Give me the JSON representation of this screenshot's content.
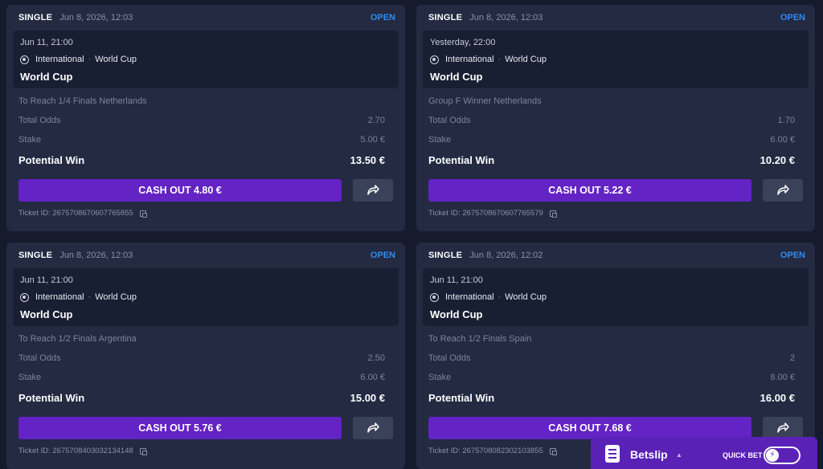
{
  "colors": {
    "background": "#151a2c",
    "card": "#232a42",
    "accent": "#6423c4",
    "open": "#2f8cf0"
  },
  "tickets": [
    {
      "type": "SINGLE",
      "placed": "Jun 8, 2026, 12:03",
      "status": "OPEN",
      "event_time": "Jun 11, 21:00",
      "category": "International",
      "competition": "World Cup",
      "event_title": "World Cup",
      "market": "To Reach 1/4 Finals Netherlands",
      "odds_label": "Total Odds",
      "odds": "2.70",
      "stake_label": "Stake",
      "stake": "5.00 €",
      "win_label": "Potential Win",
      "win": "13.50 €",
      "cashout": "CASH OUT 4.80 €",
      "ticket_id": "Ticket ID: 2675708670607765855"
    },
    {
      "type": "SINGLE",
      "placed": "Jun 8, 2026, 12:03",
      "status": "OPEN",
      "event_time": "Yesterday, 22:00",
      "category": "International",
      "competition": "World Cup",
      "event_title": "World Cup",
      "market": "Group F Winner Netherlands",
      "odds_label": "Total Odds",
      "odds": "1.70",
      "stake_label": "Stake",
      "stake": "6.00 €",
      "win_label": "Potential Win",
      "win": "10.20 €",
      "cashout": "CASH OUT 5.22 €",
      "ticket_id": "Ticket ID: 2675708670607765579"
    },
    {
      "type": "SINGLE",
      "placed": "Jun 8, 2026, 12:03",
      "status": "OPEN",
      "event_time": "Jun 11, 21:00",
      "category": "International",
      "competition": "World Cup",
      "event_title": "World Cup",
      "market": "To Reach 1/2 Finals Argentina",
      "odds_label": "Total Odds",
      "odds": "2.50",
      "stake_label": "Stake",
      "stake": "6.00 €",
      "win_label": "Potential Win",
      "win": "15.00 €",
      "cashout": "CASH OUT 5.76 €",
      "ticket_id": "Ticket ID: 2675708403032134148"
    },
    {
      "type": "SINGLE",
      "placed": "Jun 8, 2026, 12:02",
      "status": "OPEN",
      "event_time": "Jun 11, 21:00",
      "category": "International",
      "competition": "World Cup",
      "event_title": "World Cup",
      "market": "To Reach 1/2 Finals Spain",
      "odds_label": "Total Odds",
      "odds": "2",
      "stake_label": "Stake",
      "stake": "8.00 €",
      "win_label": "Potential Win",
      "win": "16.00 €",
      "cashout": "CASH OUT 7.68 €",
      "ticket_id": "Ticket ID: 2675708082302103855"
    }
  ],
  "betslip": {
    "label": "Betslip",
    "quick_bet_label": "QUICK BET",
    "quick_bet_on": false
  }
}
